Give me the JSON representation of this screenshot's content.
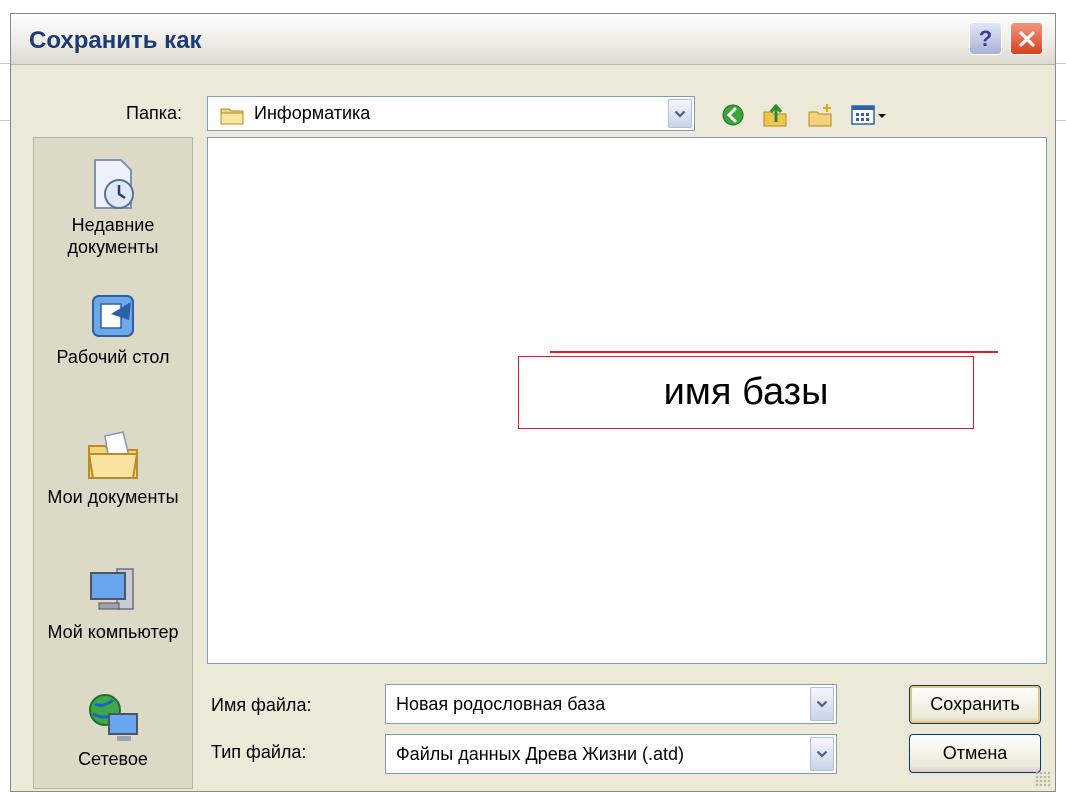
{
  "window": {
    "title": "Сохранить как",
    "help_label": "?"
  },
  "toolbar": {
    "folder_label": "Папка:",
    "folder_value": "Информатика",
    "icons": [
      "back-icon",
      "up-folder-icon",
      "new-folder-icon",
      "view-menu-icon"
    ]
  },
  "places": [
    {
      "label": "Недавние документы",
      "icon": "recent-documents-icon"
    },
    {
      "label": "Рабочий стол",
      "icon": "desktop-icon"
    },
    {
      "label": "Мои документы",
      "icon": "my-documents-icon"
    },
    {
      "label": "Мой компьютер",
      "icon": "my-computer-icon"
    },
    {
      "label": "Сетевое",
      "icon": "network-icon"
    }
  ],
  "callout": {
    "text": "имя базы"
  },
  "filename": {
    "label": "Имя файла:",
    "value": "Новая родословная база"
  },
  "filetype": {
    "label": "Тип файла:",
    "value": "Файлы данных Древа Жизни (.atd)"
  },
  "buttons": {
    "save": "Сохранить",
    "cancel": "Отмена"
  },
  "colors": {
    "window_bg": "#ece9d8",
    "title_text": "#1d3a78",
    "callout_border": "#e1201f"
  }
}
